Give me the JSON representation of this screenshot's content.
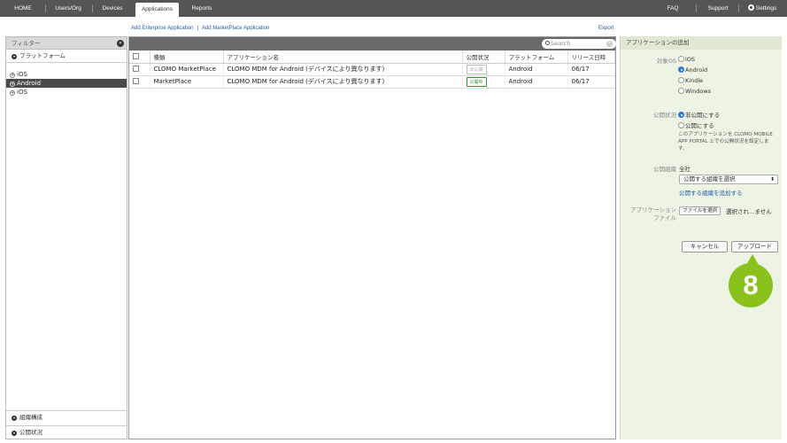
{
  "nav": {
    "home": "HOME",
    "users_org": "Users/Org",
    "devices": "Devices",
    "applications": "Applications",
    "reports": "Reports",
    "faq": "FAQ",
    "support": "Support",
    "settings": "Settings"
  },
  "links": {
    "add_enterprise": "Add Enterprise Application",
    "separator": "|",
    "add_marketplace": "Add MarketPlace Application",
    "export": "Export"
  },
  "filter": {
    "title": "フィルター",
    "collapse_icon": "«",
    "platform_section": "プラットフォーム",
    "items": [
      "iOS",
      "Android",
      "iOS"
    ],
    "active_index": 1,
    "org_section": "組織構成",
    "status_section": "公開状況"
  },
  "table": {
    "search_placeholder": "Search",
    "columns": [
      "種類",
      "アプリケーション名",
      "公開状況",
      "プラットフォーム",
      "リリース日時"
    ],
    "rows": [
      {
        "type": "CLOMO MarketPlace",
        "name": "CLOMO MDM for Android (デバイスにより異なります)",
        "status": "非公開",
        "platform": "Android",
        "date": "06/17"
      },
      {
        "type": "MarketPlace",
        "name": "CLOMO MDM for Android (デバイスにより異なります)",
        "status": "公開中",
        "platform": "Android",
        "date": "06/17"
      }
    ]
  },
  "panel": {
    "title": "アプリケーションの追加",
    "os_label": "対象OS",
    "os_options": [
      "iOS",
      "Android",
      "Kindle",
      "Windows"
    ],
    "os_selected": "Android",
    "status_label": "公開状況",
    "status_options": [
      "非公開にする",
      "公開にする"
    ],
    "status_selected": "非公開にする",
    "status_desc_1": "このアプリケーションを CLOMO MOBILE",
    "status_desc_2": "APP PORTAL 上での公開状況を設定しま",
    "status_desc_3": "す。",
    "org_label": "公開組織",
    "org_value": "全社",
    "org_select": "公開する組織を選択",
    "org_add_link": "公開する組織を追加する",
    "file_label_1": "アプリケーション",
    "file_label_2": "ファイル",
    "file_button": "ファイルを選択",
    "file_status": "選択され…ません",
    "cancel": "キャンセル",
    "upload": "アップロード"
  },
  "callout": {
    "number": "8",
    "color": "#8ac21d"
  }
}
